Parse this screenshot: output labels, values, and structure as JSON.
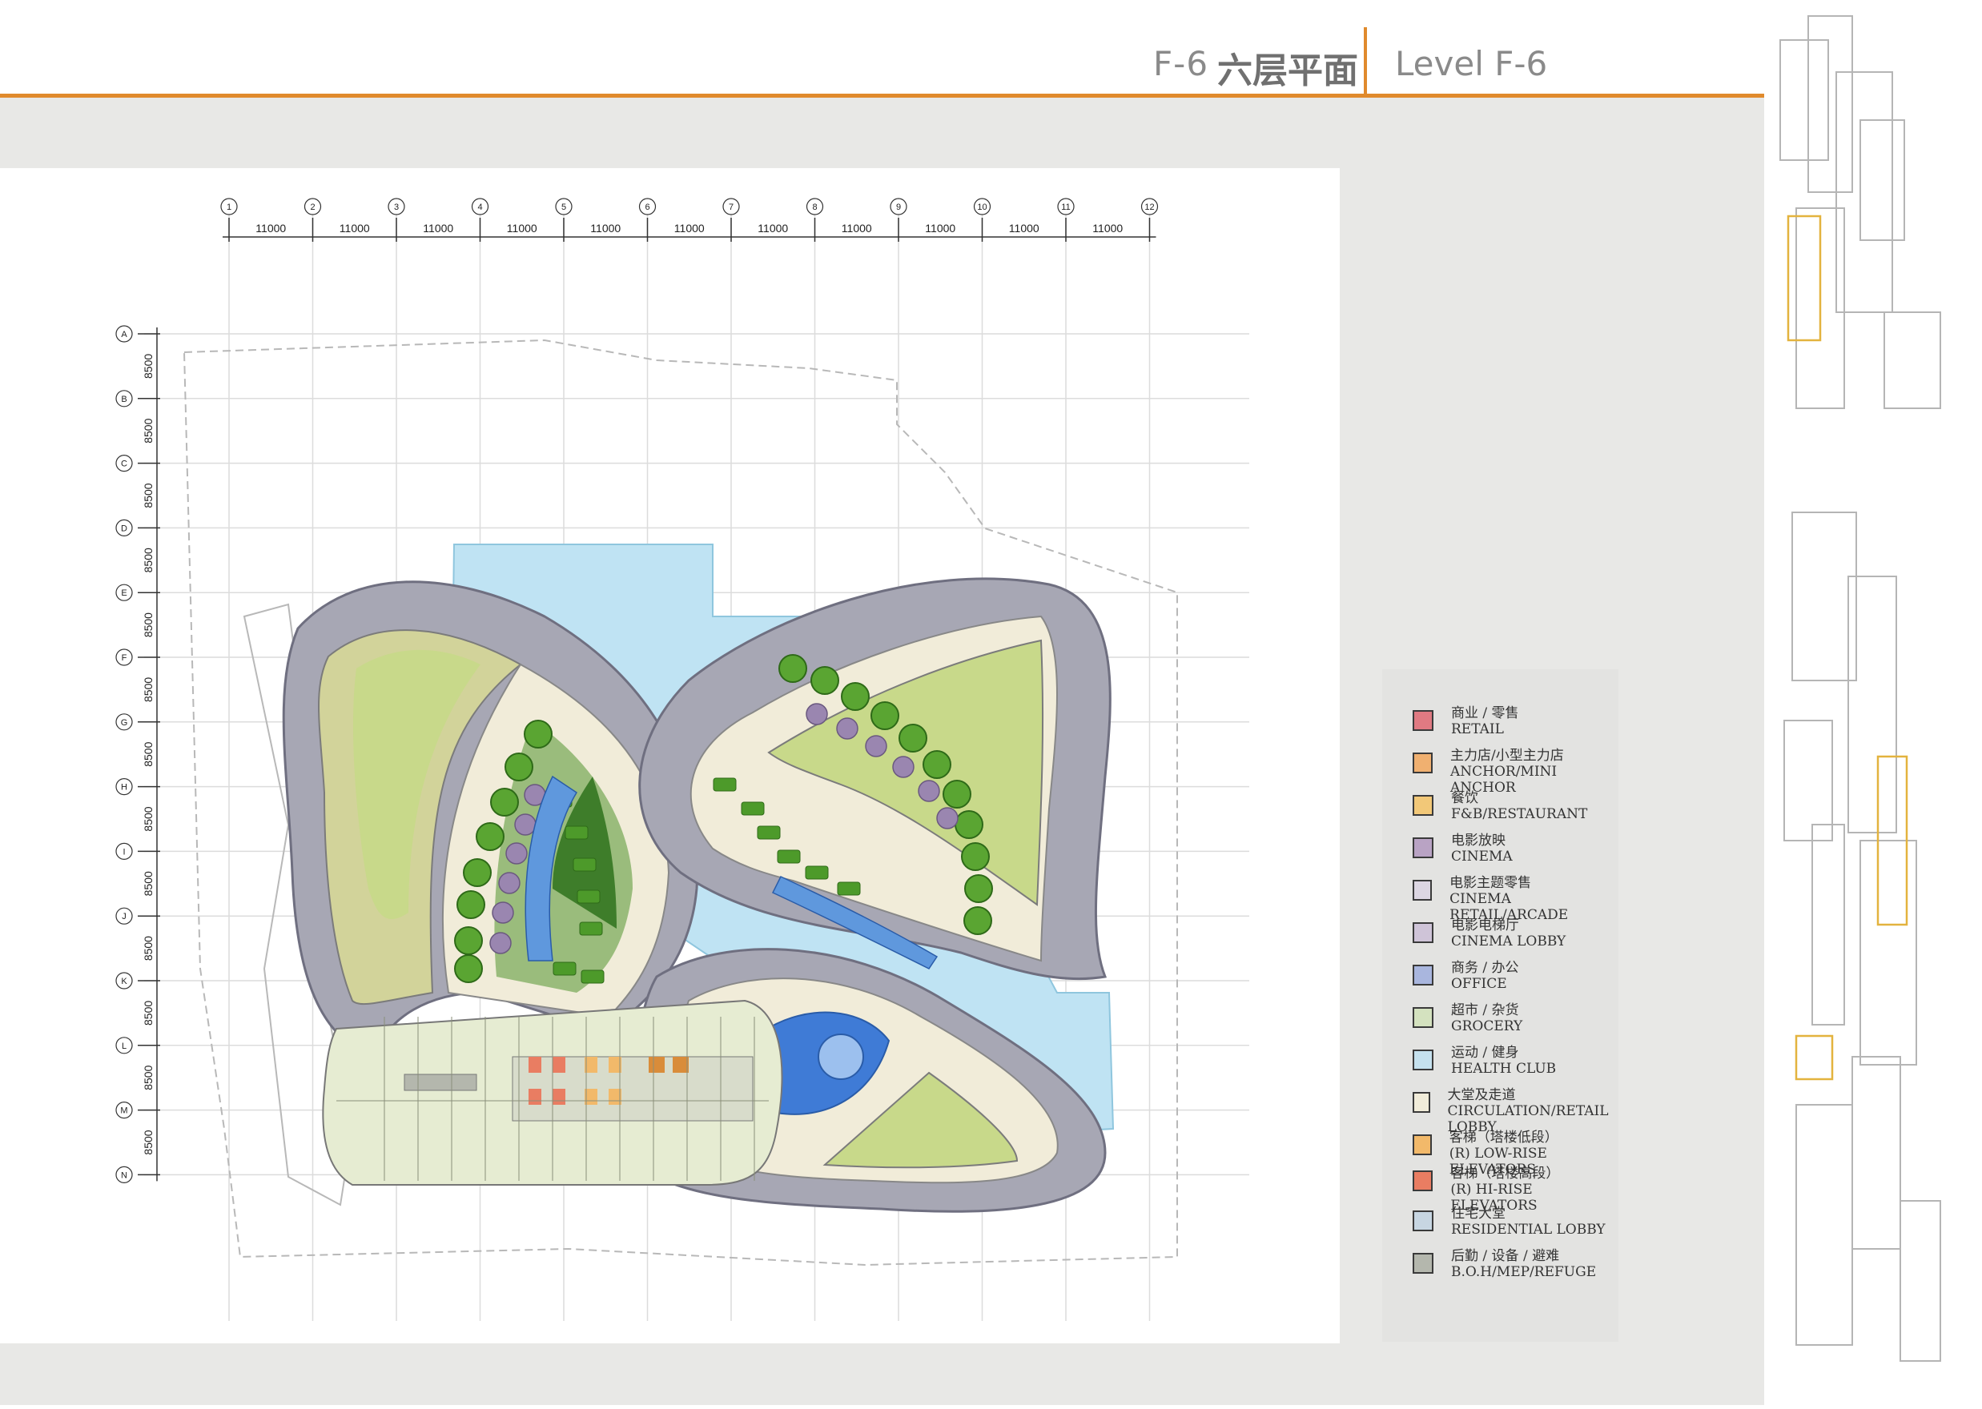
{
  "header": {
    "code": "F-6",
    "title_cn": "六层平面",
    "title_en": "Level F-6"
  },
  "grid": {
    "columns": [
      "1",
      "2",
      "3",
      "4",
      "5",
      "6",
      "7",
      "8",
      "9",
      "10",
      "11",
      "12"
    ],
    "column_spacing": "11000",
    "rows": [
      "A",
      "B",
      "C",
      "D",
      "E",
      "F",
      "G",
      "H",
      "I",
      "J",
      "K",
      "L",
      "M",
      "N"
    ],
    "row_spacing": "8500"
  },
  "legend": [
    {
      "cn": "商业 / 零售",
      "en": "RETAIL",
      "color": "#e07a82"
    },
    {
      "cn": "主力店/小型主力店",
      "en": "ANCHOR/MINI ANCHOR",
      "color": "#f0b070"
    },
    {
      "cn": "餐饮",
      "en": "F&B/RESTAURANT",
      "color": "#f2c878"
    },
    {
      "cn": "电影放映",
      "en": "CINEMA",
      "color": "#b9a3c4"
    },
    {
      "cn": "电影主题零售",
      "en": "CINEMA RETAIL/ARCADE",
      "color": "#dcd6e2"
    },
    {
      "cn": "电影电梯厅",
      "en": "CINEMA LOBBY",
      "color": "#cfc4d8"
    },
    {
      "cn": "商务 / 办公",
      "en": "OFFICE",
      "color": "#a9b6de"
    },
    {
      "cn": "超市 / 杂货",
      "en": "GROCERY",
      "color": "#d4e2bf"
    },
    {
      "cn": "运动 / 健身",
      "en": "HEALTH CLUB",
      "color": "#c5e1ee"
    },
    {
      "cn": "大堂及走道",
      "en": "CIRCULATION/RETAIL LOBBY",
      "color": "#f1ecd9"
    },
    {
      "cn": "客梯（塔楼低段）",
      "en": "(R) LOW-RISE ELEVATORS",
      "color": "#f2b96a"
    },
    {
      "cn": "客梯（塔楼高段）",
      "en": "(R) HI-RISE ELEVATORS",
      "color": "#e97d62"
    },
    {
      "cn": "住宅大堂",
      "en": "RESIDENTIAL LOBBY",
      "color": "#c7d6e2"
    },
    {
      "cn": "后勤 / 设备 / 避难",
      "en": "B.O.H/MEP/REFUGE",
      "color": "#b4b7ad"
    }
  ],
  "colors": {
    "accent": "#e08a2c",
    "garden": "#c8d98a",
    "ring": "#a7a7b4",
    "water": "#bfe3f3",
    "pool": "#3f7bd6",
    "circulation": "#f1ecd9",
    "green_block": "#4d9a2a",
    "seat": "#9a86b0"
  }
}
